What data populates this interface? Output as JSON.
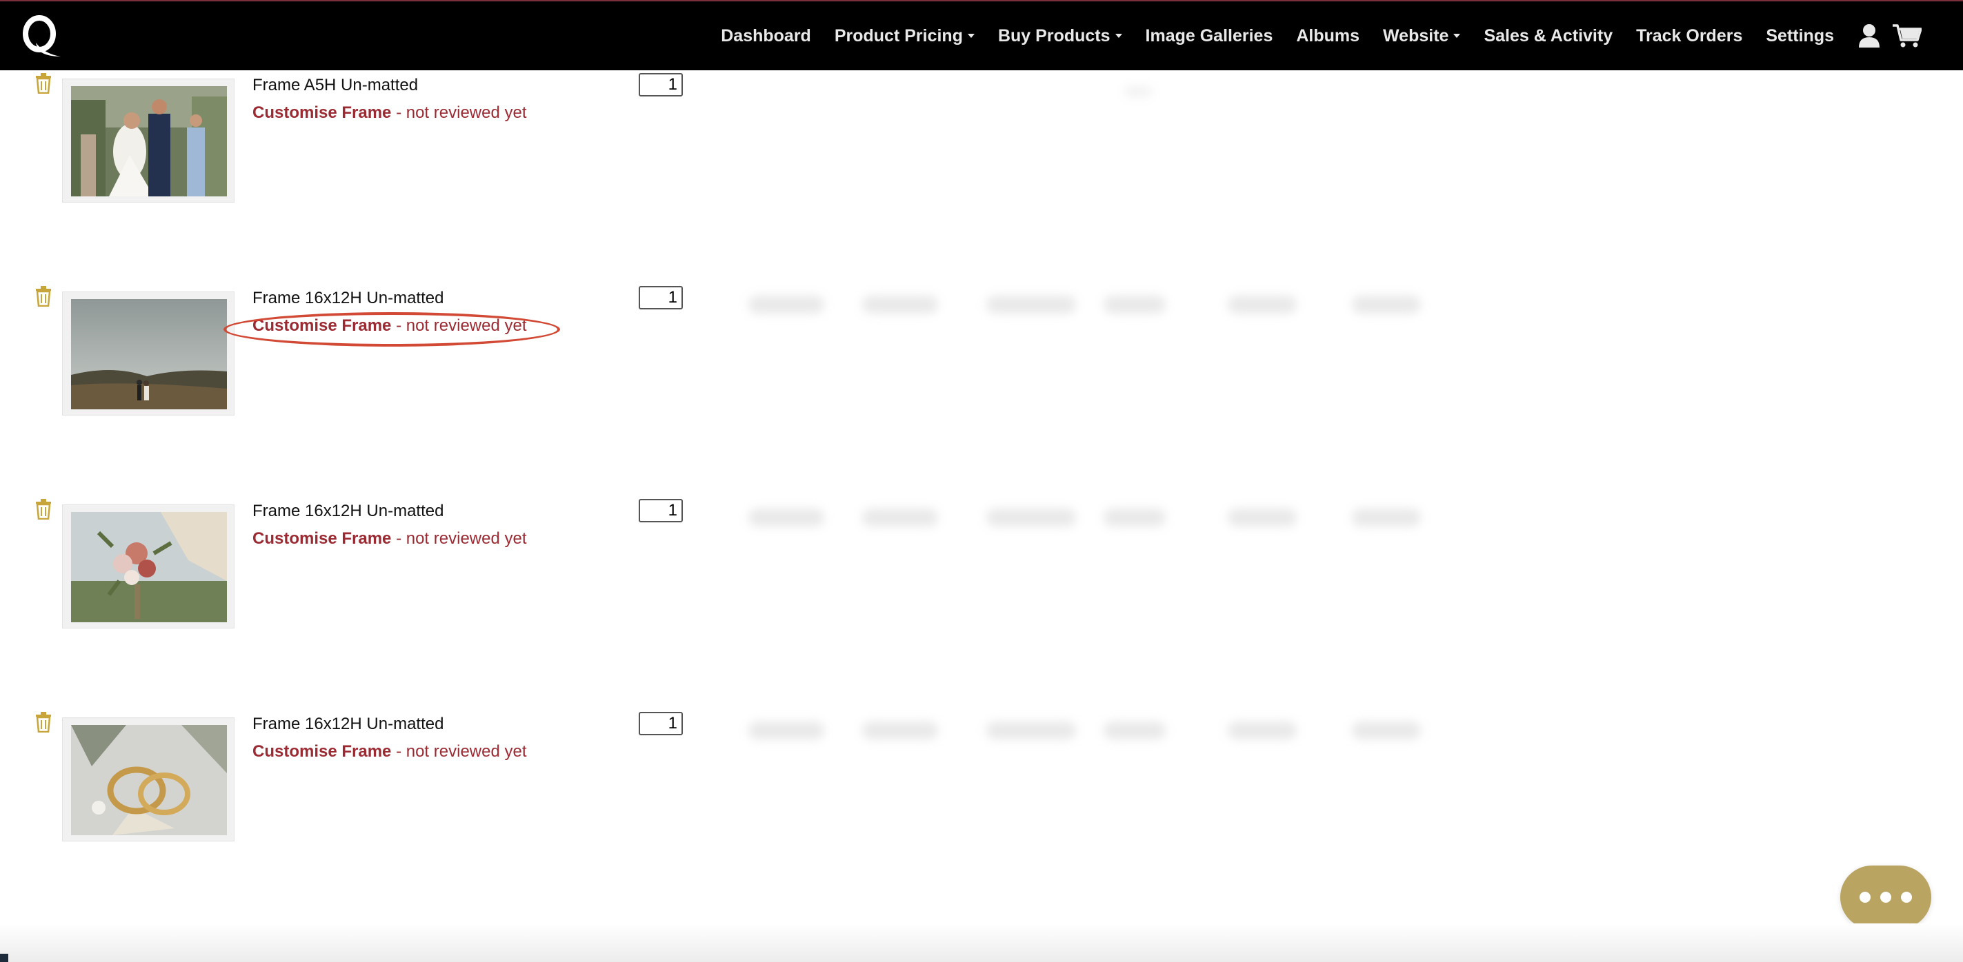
{
  "navbar": {
    "logo_text": "Q",
    "items": [
      {
        "label": "Dashboard",
        "has_dropdown": false
      },
      {
        "label": "Product Pricing",
        "has_dropdown": true
      },
      {
        "label": "Buy Products",
        "has_dropdown": true
      },
      {
        "label": "Image Galleries",
        "has_dropdown": false
      },
      {
        "label": "Albums",
        "has_dropdown": false
      },
      {
        "label": "Website",
        "has_dropdown": true
      },
      {
        "label": "Sales & Activity",
        "has_dropdown": false
      },
      {
        "label": "Track Orders",
        "has_dropdown": false
      },
      {
        "label": "Settings",
        "has_dropdown": false
      }
    ],
    "icons": [
      "user-icon",
      "cart-icon"
    ]
  },
  "cart": {
    "items": [
      {
        "title": "Frame A5H Un-matted",
        "customise_link": "Customise Frame",
        "status": " - not reviewed yet",
        "quantity": "1",
        "thumbnail": "wedding-couple-with-guests"
      },
      {
        "title": "Frame 16x12H Un-matted",
        "customise_link": "Customise Frame",
        "status": " - not reviewed yet",
        "quantity": "1",
        "thumbnail": "couple-on-hill-landscape"
      },
      {
        "title": "Frame 16x12H Un-matted",
        "customise_link": "Customise Frame",
        "status": " - not reviewed yet",
        "quantity": "1",
        "thumbnail": "bridal-bouquet"
      },
      {
        "title": "Frame 16x12H Un-matted",
        "customise_link": "Customise Frame",
        "status": " - not reviewed yet",
        "quantity": "1",
        "thumbnail": "wedding-rings"
      }
    ]
  },
  "colors": {
    "navbar_bg": "#000000",
    "customise_text": "#9b2a33",
    "trash_icon": "#c8a53a",
    "chat_button": "#b9a461",
    "highlight": "#d24a35"
  },
  "chat": {
    "icon": "ellipsis-icon"
  }
}
